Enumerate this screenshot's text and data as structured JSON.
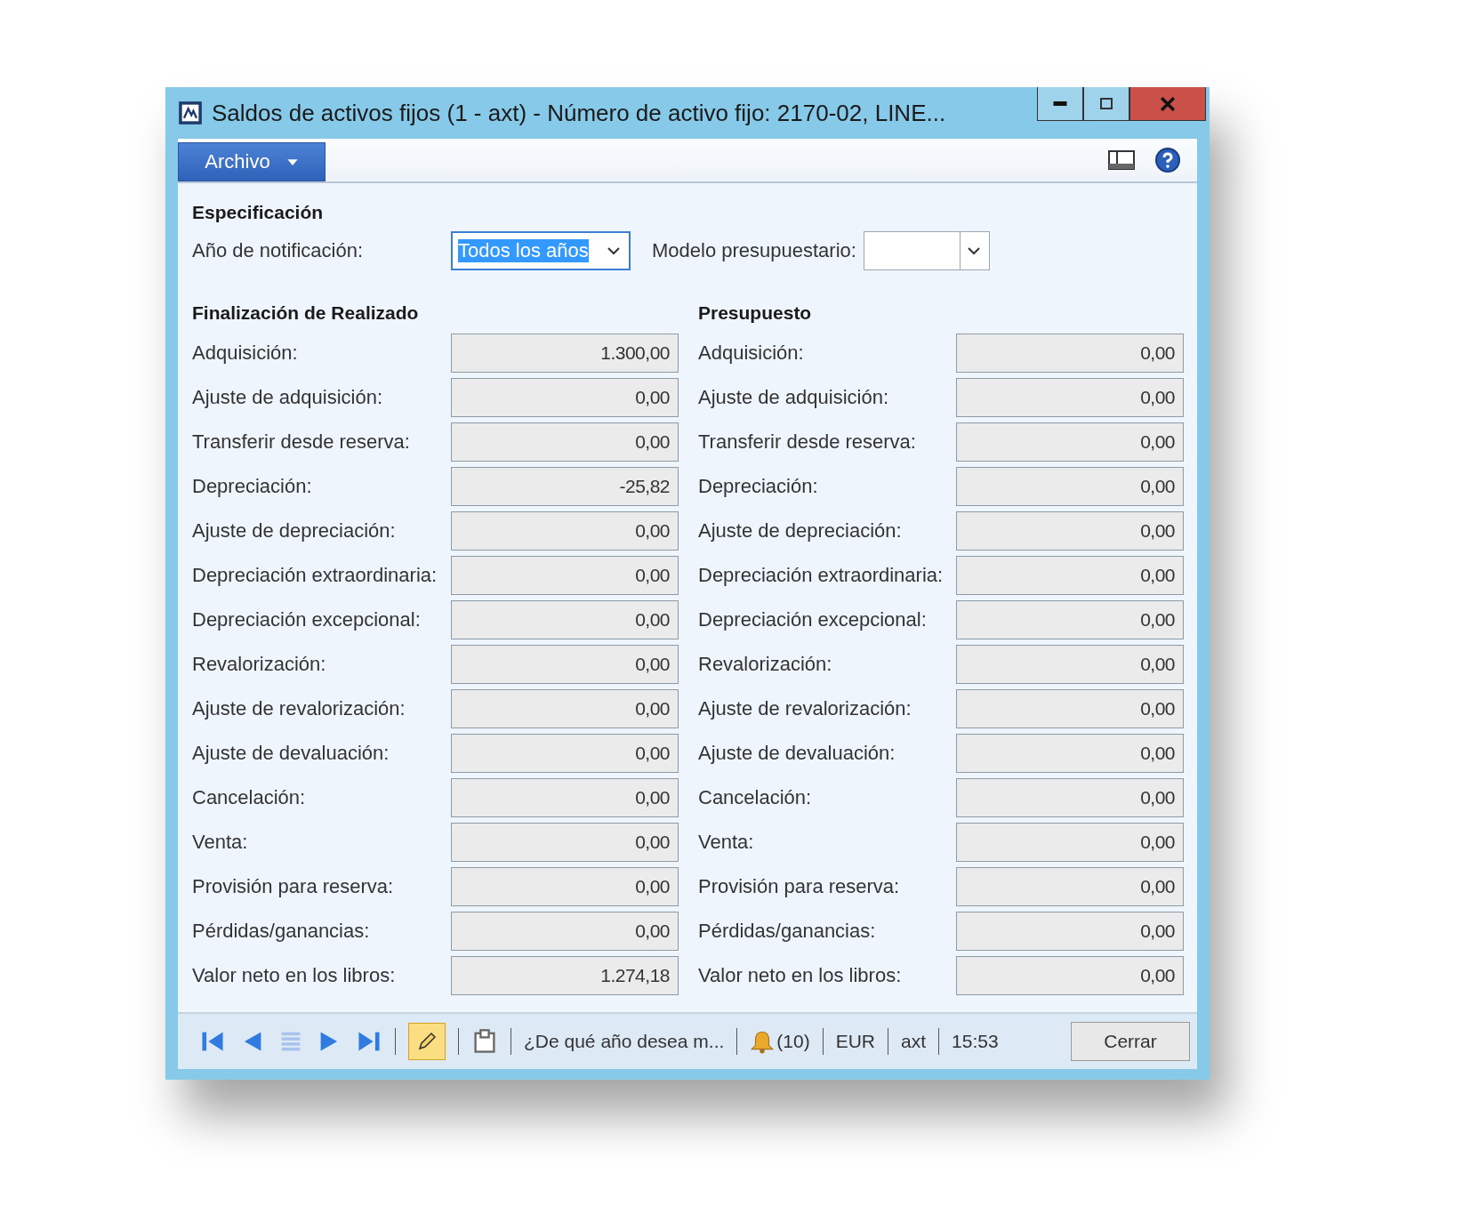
{
  "window": {
    "title": "Saldos de activos fijos (1 - axt) - Número de activo fijo: 2170-02, LINE..."
  },
  "menu": {
    "label": "Archivo"
  },
  "specification": {
    "heading": "Especificación",
    "year": {
      "label": "Año de notificación:",
      "value": "Todos los años",
      "text_selected": true
    },
    "budget_model": {
      "label": "Modelo presupuestario:"
    }
  },
  "sections": [
    {
      "heading": "Finalización de Realizado",
      "rows": [
        {
          "label": "Adquisición:",
          "value": "1.300,00"
        },
        {
          "label": "Ajuste de adquisición:",
          "value": "0,00"
        },
        {
          "label": "Transferir desde reserva:",
          "value": "0,00"
        },
        {
          "label": "Depreciación:",
          "value": "-25,82"
        },
        {
          "label": "Ajuste de depreciación:",
          "value": "0,00"
        },
        {
          "label": "Depreciación extraordinaria:",
          "value": "0,00"
        },
        {
          "label": "Depreciación excepcional:",
          "value": "0,00"
        },
        {
          "label": "Revalorización:",
          "value": "0,00"
        },
        {
          "label": "Ajuste de revalorización:",
          "value": "0,00"
        },
        {
          "label": "Ajuste de devaluación:",
          "value": "0,00"
        },
        {
          "label": "Cancelación:",
          "value": "0,00"
        },
        {
          "label": "Venta:",
          "value": "0,00"
        },
        {
          "label": "Provisión para reserva:",
          "value": "0,00"
        },
        {
          "label": "Pérdidas/ganancias:",
          "value": "0,00"
        },
        {
          "label": "Valor neto en los libros:",
          "value": "1.274,18"
        }
      ]
    },
    {
      "heading": "Presupuesto",
      "rows": [
        {
          "label": "Adquisición:",
          "value": "0,00"
        },
        {
          "label": "Ajuste de adquisición:",
          "value": "0,00"
        },
        {
          "label": "Transferir desde reserva:",
          "value": "0,00"
        },
        {
          "label": "Depreciación:",
          "value": "0,00"
        },
        {
          "label": "Ajuste de depreciación:",
          "value": "0,00"
        },
        {
          "label": "Depreciación extraordinaria:",
          "value": "0,00"
        },
        {
          "label": "Depreciación excepcional:",
          "value": "0,00"
        },
        {
          "label": "Revalorización:",
          "value": "0,00"
        },
        {
          "label": "Ajuste de revalorización:",
          "value": "0,00"
        },
        {
          "label": "Ajuste de devaluación:",
          "value": "0,00"
        },
        {
          "label": "Cancelación:",
          "value": "0,00"
        },
        {
          "label": "Venta:",
          "value": "0,00"
        },
        {
          "label": "Provisión para reserva:",
          "value": "0,00"
        },
        {
          "label": "Pérdidas/ganancias:",
          "value": "0,00"
        },
        {
          "label": "Valor neto en los libros:",
          "value": "0,00"
        }
      ]
    }
  ],
  "status_bar": {
    "edit_mode": true,
    "message": "¿De qué año desea m...",
    "notifications": "(10)",
    "currency": "EUR",
    "company": "axt",
    "time": "15:53",
    "close_button": "Cerrar"
  }
}
